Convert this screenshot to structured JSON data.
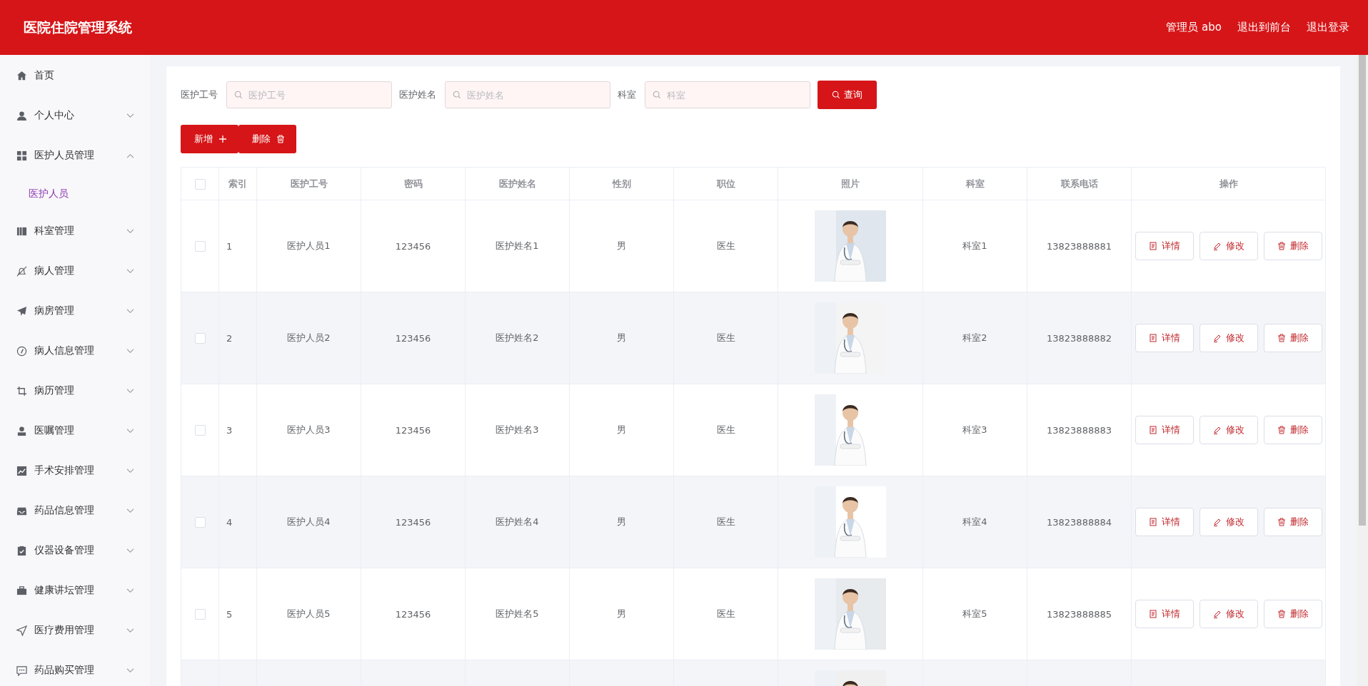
{
  "header": {
    "title": "医院住院管理系统",
    "user": "管理员 abo",
    "links": [
      "退出到前台",
      "退出登录"
    ]
  },
  "sidebar": {
    "items": [
      {
        "label": "首页",
        "kind": "link"
      },
      {
        "label": "个人中心",
        "kind": "menu",
        "expanded": false
      },
      {
        "label": "医护人员管理",
        "kind": "menu",
        "expanded": true,
        "children": [
          {
            "label": "医护人员",
            "selected": true
          }
        ]
      },
      {
        "label": "科室管理",
        "kind": "menu",
        "expanded": false
      },
      {
        "label": "病人管理",
        "kind": "menu",
        "expanded": false
      },
      {
        "label": "病房管理",
        "kind": "menu",
        "expanded": false
      },
      {
        "label": "病人信息管理",
        "kind": "menu",
        "expanded": false
      },
      {
        "label": "病历管理",
        "kind": "menu",
        "expanded": false
      },
      {
        "label": "医嘱管理",
        "kind": "menu",
        "expanded": false
      },
      {
        "label": "手术安排管理",
        "kind": "menu",
        "expanded": false
      },
      {
        "label": "药品信息管理",
        "kind": "menu",
        "expanded": false
      },
      {
        "label": "仪器设备管理",
        "kind": "menu",
        "expanded": false
      },
      {
        "label": "健康讲坛管理",
        "kind": "menu",
        "expanded": false
      },
      {
        "label": "医疗费用管理",
        "kind": "menu",
        "expanded": false
      },
      {
        "label": "药品购买管理",
        "kind": "menu",
        "expanded": false
      }
    ]
  },
  "search": {
    "fields": [
      {
        "label": "医护工号",
        "placeholder": "医护工号"
      },
      {
        "label": "医护姓名",
        "placeholder": "医护姓名"
      },
      {
        "label": "科室",
        "placeholder": "科室"
      }
    ],
    "button": "查询"
  },
  "actions": [
    {
      "label": "新增",
      "kind": "add"
    },
    {
      "label": "删除",
      "kind": "delete"
    }
  ],
  "table": {
    "select_all": {
      "checked": false
    },
    "columns": [
      "索引",
      "医护工号",
      "密码",
      "医护姓名",
      "性别",
      "职位",
      "照片",
      "科室",
      "联系电话",
      "操作"
    ],
    "rows": [
      {
        "checked": false,
        "cells": [
          "1",
          "医护人员1",
          "123456",
          "医护姓名1",
          "男",
          "医生",
          "科室1",
          "13823888881"
        ],
        "photo": {
          "kind": "picture"
        },
        "buttons": [
          "详情",
          "修改",
          "删除"
        ]
      },
      {
        "checked": false,
        "cells": [
          "2",
          "医护人员2",
          "123456",
          "医护姓名2",
          "男",
          "医生",
          "科室2",
          "13823888882"
        ],
        "photo": {
          "kind": "picture"
        },
        "buttons": [
          "详情",
          "修改",
          "删除"
        ]
      },
      {
        "checked": false,
        "cells": [
          "3",
          "医护人员3",
          "123456",
          "医护姓名3",
          "男",
          "医生",
          "科室3",
          "13823888883"
        ],
        "photo": {
          "kind": "picture"
        },
        "buttons": [
          "详情",
          "修改",
          "删除"
        ]
      },
      {
        "checked": false,
        "cells": [
          "4",
          "医护人员4",
          "123456",
          "医护姓名4",
          "男",
          "医生",
          "科室4",
          "13823888884"
        ],
        "photo": {
          "kind": "picture"
        },
        "buttons": [
          "详情",
          "修改",
          "删除"
        ]
      },
      {
        "checked": false,
        "cells": [
          "5",
          "医护人员5",
          "123456",
          "医护姓名5",
          "男",
          "医生",
          "科室5",
          "13823888885"
        ],
        "photo": {
          "kind": "picture"
        },
        "buttons": [
          "详情",
          "修改",
          "删除"
        ]
      },
      {
        "photo": {
          "kind": "picture"
        }
      }
    ]
  }
}
